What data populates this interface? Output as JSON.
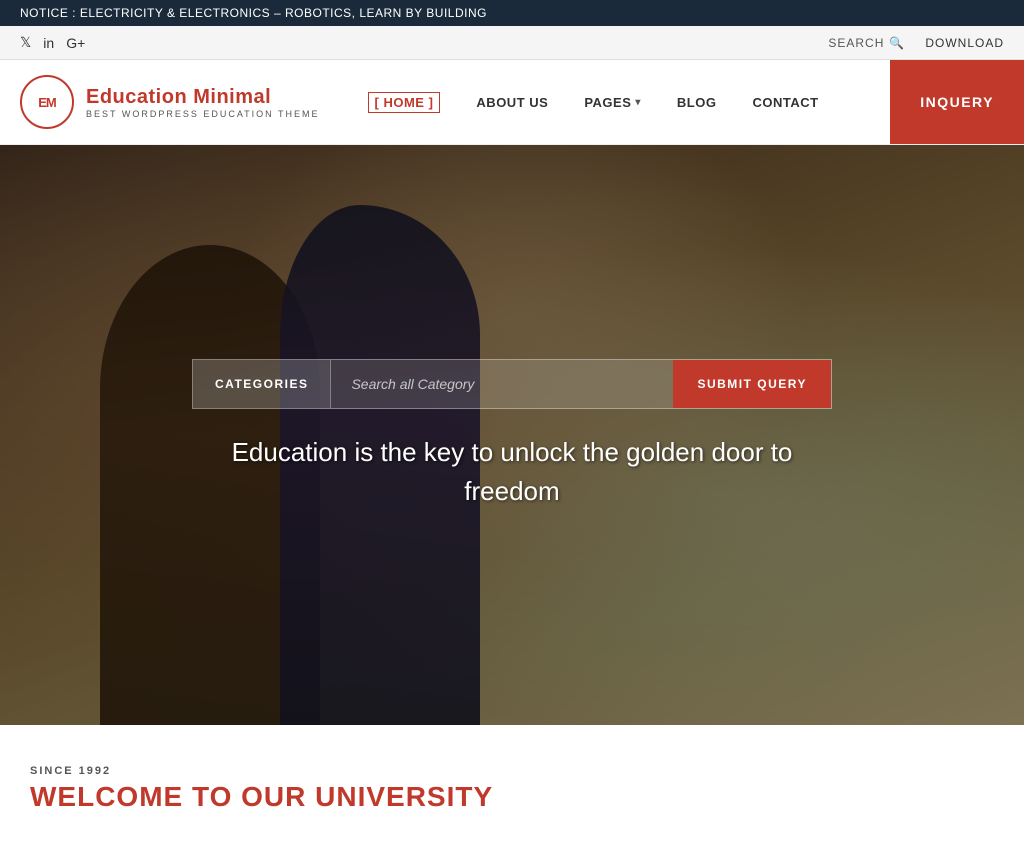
{
  "notice": {
    "text": "NOTICE :  ELECTRICITY & ELECTRONICS – ROBOTICS, LEARN BY BUILDING"
  },
  "social": {
    "twitter": "𝕋",
    "linkedin": "in",
    "googleplus": "G+"
  },
  "topbar": {
    "search_label": "SEARCH",
    "download_label": "DOWNLOAD"
  },
  "logo": {
    "badge": "EM",
    "title": "Education Minimal",
    "subtitle": "BEST WORDPRESS EDUCATION THEME"
  },
  "nav": {
    "items": [
      {
        "label": "[ HOME ]",
        "active": true
      },
      {
        "label": "ABOUT US",
        "active": false
      },
      {
        "label": "PAGES",
        "active": false,
        "has_dropdown": true
      },
      {
        "label": "BLOG",
        "active": false
      },
      {
        "label": "CONTACT",
        "active": false
      }
    ],
    "inquiry_label": "INQUERY"
  },
  "hero": {
    "search": {
      "categories_label": "CATEGORIES",
      "input_placeholder": "Search all Category",
      "submit_label": "SUBMIT QUERY"
    },
    "quote": "Education is the key to unlock the golden door to freedom"
  },
  "below": {
    "since_label": "SINCE 1992",
    "welcome_label": "WELCOME TO OUR UNIVERSITY"
  }
}
